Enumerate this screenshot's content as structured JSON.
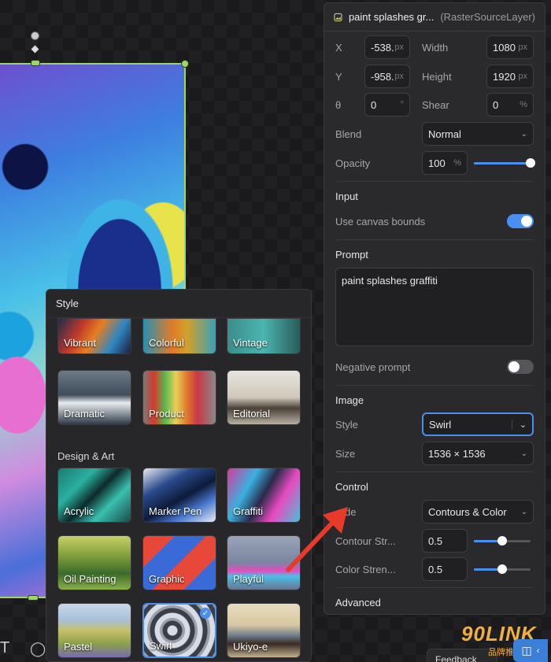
{
  "layer": {
    "name": "paint splashes gr...",
    "type": "(RasterSourceLayer)",
    "icon": "image-icon"
  },
  "transform": {
    "x": {
      "label": "X",
      "value": "-538.",
      "unit": "px"
    },
    "width": {
      "label": "Width",
      "value": "1080",
      "unit": "px"
    },
    "y": {
      "label": "Y",
      "value": "-958.",
      "unit": "px"
    },
    "height": {
      "label": "Height",
      "value": "1920",
      "unit": "px"
    },
    "rotation": {
      "label": "θ",
      "value": "0",
      "unit": "°"
    },
    "shear": {
      "label": "Shear",
      "value": "0",
      "unit": "%"
    }
  },
  "blend": {
    "label": "Blend",
    "value": "Normal"
  },
  "opacity": {
    "label": "Opacity",
    "value": "100",
    "unit": "%",
    "level": 1.0
  },
  "input": {
    "title": "Input",
    "canvas_bounds_label": "Use canvas bounds",
    "canvas_bounds_on": true
  },
  "prompt": {
    "title": "Prompt",
    "value": "paint splashes graffiti"
  },
  "negative_prompt": {
    "label": "Negative prompt",
    "on": false
  },
  "image": {
    "title": "Image",
    "style_label": "Style",
    "style_value": "Swirl",
    "size_label": "Size",
    "size_value": "1536 × 1536"
  },
  "control": {
    "title": "Control",
    "mode_label": "de",
    "mode_value": "Contours & Color",
    "contour_label": "Contour Str...",
    "contour_value": "0.5",
    "contour_level": 0.5,
    "color_label": "Color Stren...",
    "color_value": "0.5",
    "color_level": 0.5
  },
  "advanced": {
    "title": "Advanced"
  },
  "style_popup": {
    "title": "Style",
    "top_row": [
      "Vibrant",
      "Colorful",
      "Vintage"
    ],
    "row2": [
      "Dramatic",
      "Product",
      "Editorial"
    ],
    "group_design": "Design & Art",
    "row3": [
      "Acrylic",
      "Marker Pen",
      "Graffiti"
    ],
    "row4": [
      "Oil Painting",
      "Graphic",
      "Playful"
    ],
    "row5": [
      "Pastel",
      "Swirl",
      "Ukiyo-e"
    ],
    "selected": "Swirl"
  },
  "watermark": {
    "text": "90LINK",
    "sub": "品牌推"
  },
  "feedback": "Feedback",
  "colors": {
    "accent": "#4a8ff0",
    "selection": "#9ad66a",
    "arrow": "#e83a2a"
  }
}
